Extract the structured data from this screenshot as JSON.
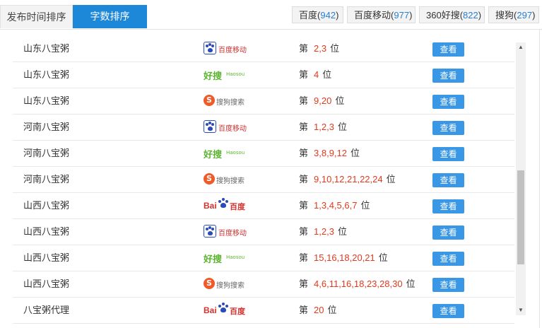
{
  "tabs": [
    {
      "label": "发布时间排序",
      "active": false
    },
    {
      "label": "字数排序",
      "active": true
    }
  ],
  "engine_counts": [
    {
      "name": "百度",
      "count": "942"
    },
    {
      "name": "百度移动",
      "count": "977"
    },
    {
      "name": "360好搜",
      "count": "822"
    },
    {
      "name": "搜狗",
      "count": "297"
    }
  ],
  "logos": {
    "baidu_mobile": {
      "text": "百度移动"
    },
    "haosou": {
      "text": "好搜",
      "en": "Haosou"
    },
    "sogou": {
      "text": "搜狗搜索"
    },
    "baidu": {
      "text_a": "Bai",
      "text_b": "百度"
    }
  },
  "rank_prefix": "第",
  "rank_suffix": "位",
  "view_label": "查看",
  "rows": [
    {
      "keyword": "山东八宝粥",
      "engine": "baidu_mobile",
      "ranks": "2,3"
    },
    {
      "keyword": "山东八宝粥",
      "engine": "haosou",
      "ranks": "4"
    },
    {
      "keyword": "山东八宝粥",
      "engine": "sogou",
      "ranks": "9,20"
    },
    {
      "keyword": "河南八宝粥",
      "engine": "baidu_mobile",
      "ranks": "1,2,3"
    },
    {
      "keyword": "河南八宝粥",
      "engine": "haosou",
      "ranks": "3,8,9,12"
    },
    {
      "keyword": "河南八宝粥",
      "engine": "sogou",
      "ranks": "9,10,12,21,22,24"
    },
    {
      "keyword": "山西八宝粥",
      "engine": "baidu",
      "ranks": "1,3,4,5,6,7"
    },
    {
      "keyword": "山西八宝粥",
      "engine": "baidu_mobile",
      "ranks": "1,2,3"
    },
    {
      "keyword": "山西八宝粥",
      "engine": "haosou",
      "ranks": "15,16,18,20,21"
    },
    {
      "keyword": "山西八宝粥",
      "engine": "sogou",
      "ranks": "4,6,11,16,18,23,28,30"
    },
    {
      "keyword": "八宝粥代理",
      "engine": "baidu",
      "ranks": "20"
    }
  ],
  "colors": {
    "accent": "#1e88d8",
    "rank": "#e03a1e",
    "button": "#3a97e5",
    "count": "#2a7fcf"
  },
  "icons": {
    "scroll_up": "triangle-up-icon",
    "scroll_down": "triangle-down-icon"
  }
}
